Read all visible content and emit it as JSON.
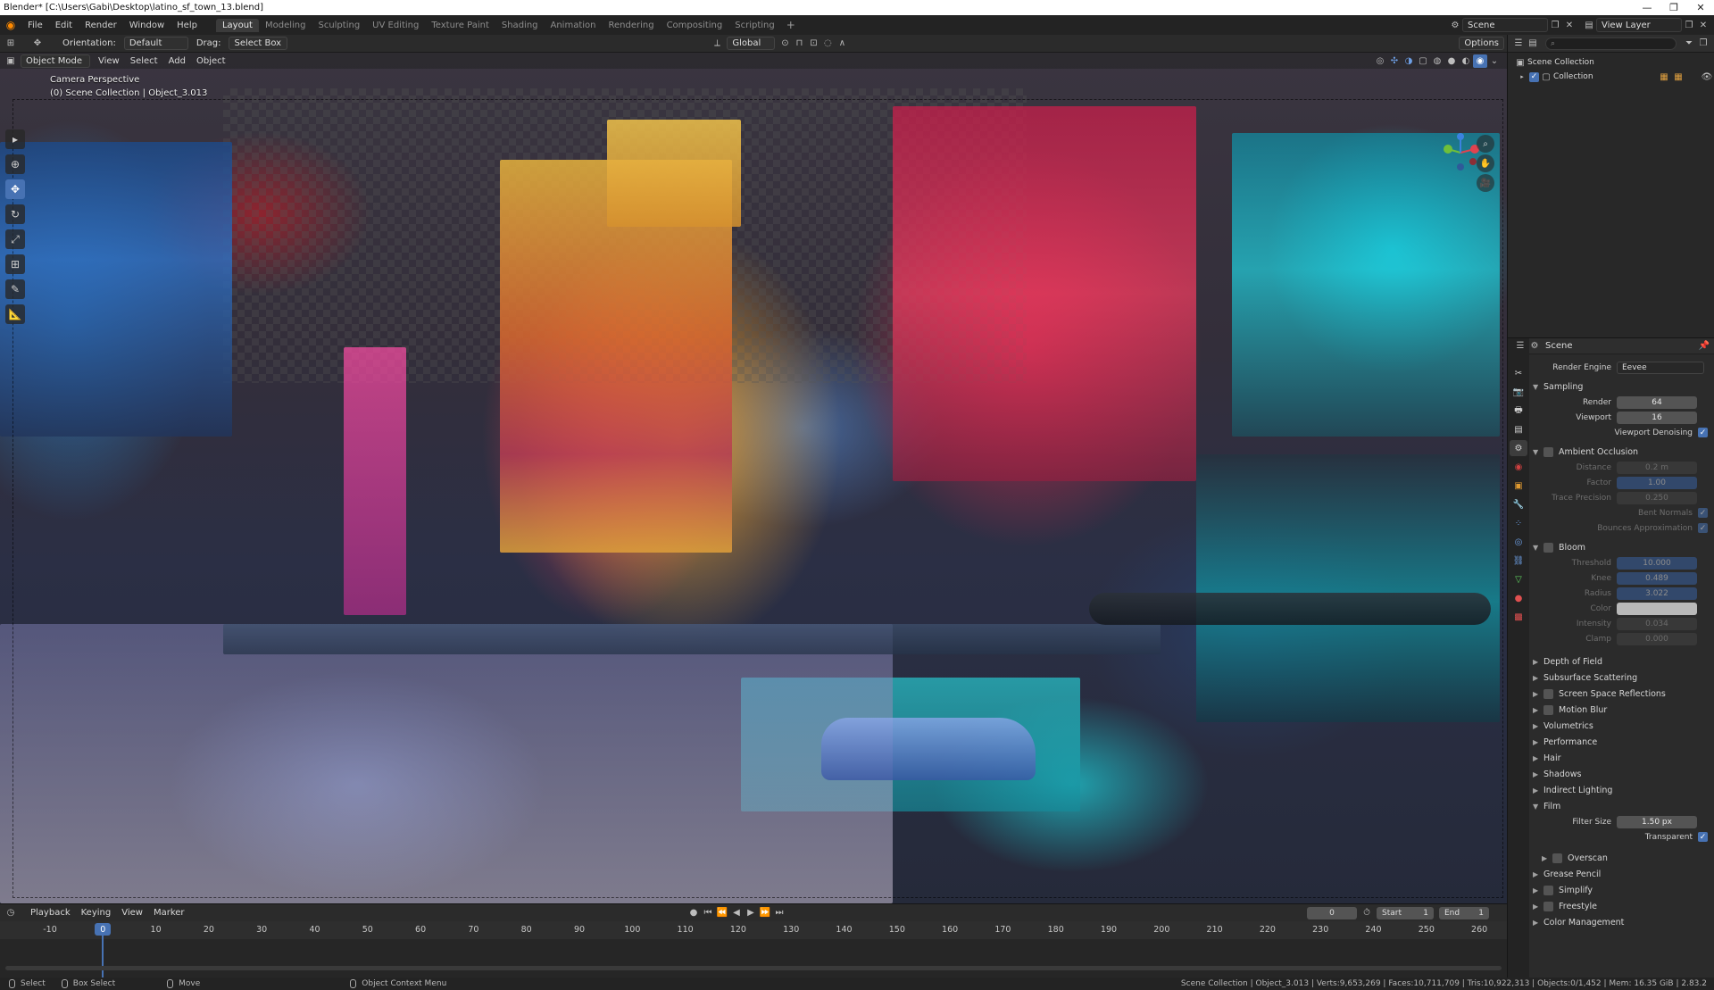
{
  "window": {
    "title": "Blender* [C:\\Users\\Gabi\\Desktop\\latino_sf_town_13.blend]",
    "minimize": "—",
    "maximize": "❐",
    "close": "✕"
  },
  "menu": [
    "File",
    "Edit",
    "Render",
    "Window",
    "Help"
  ],
  "workspaces": [
    "Layout",
    "Modeling",
    "Sculpting",
    "UV Editing",
    "Texture Paint",
    "Shading",
    "Animation",
    "Rendering",
    "Compositing",
    "Scripting"
  ],
  "active_workspace": "Layout",
  "scene_name": "Scene",
  "view_layer": "View Layer",
  "tool_header": {
    "orientation_label": "Orientation:",
    "orientation_value": "Default",
    "drag_label": "Drag:",
    "drag_value": "Select Box",
    "transform_orientation": "Global",
    "options": "Options"
  },
  "viewport_header": {
    "mode": "Object Mode",
    "menus": [
      "View",
      "Select",
      "Add",
      "Object"
    ]
  },
  "viewport": {
    "line1": "Camera Perspective",
    "line2": "(0) Scene Collection | Object_3.013"
  },
  "outliner": {
    "rows": [
      "Scene Collection",
      "Collection"
    ]
  },
  "properties": {
    "context": "Scene",
    "render_engine_label": "Render Engine",
    "render_engine": "Eevee",
    "sampling": {
      "title": "Sampling",
      "render_label": "Render",
      "render": "64",
      "viewport_label": "Viewport",
      "viewport": "16",
      "denoise_label": "Viewport Denoising"
    },
    "ao": {
      "title": "Ambient Occlusion",
      "distance_label": "Distance",
      "distance": "0.2 m",
      "factor_label": "Factor",
      "factor": "1.00",
      "trace_label": "Trace Precision",
      "trace": "0.250",
      "bent_label": "Bent Normals",
      "bounces_label": "Bounces Approximation"
    },
    "bloom": {
      "title": "Bloom",
      "threshold_label": "Threshold",
      "threshold": "10.000",
      "knee_label": "Knee",
      "knee": "0.489",
      "radius_label": "Radius",
      "radius": "3.022",
      "color_label": "Color",
      "intensity_label": "Intensity",
      "intensity": "0.034",
      "clamp_label": "Clamp",
      "clamp": "0.000"
    },
    "panels_a": [
      "Depth of Field",
      "Subsurface Scattering",
      "Screen Space Reflections",
      "Motion Blur",
      "Volumetrics",
      "Performance",
      "Hair",
      "Shadows",
      "Indirect Lighting"
    ],
    "film": {
      "title": "Film",
      "filter_label": "Filter Size",
      "filter": "1.50 px",
      "transparent_label": "Transparent",
      "overscan_label": "Overscan"
    },
    "panels_b": [
      "Grease Pencil",
      "Simplify",
      "Freestyle",
      "Color Management"
    ]
  },
  "timeline": {
    "menus": [
      "Playback",
      "Keying",
      "View",
      "Marker"
    ],
    "current_frame": "0",
    "start_label": "Start",
    "start": "1",
    "end_label": "End",
    "end": "1",
    "ticks": [
      "-10",
      "0",
      "10",
      "20",
      "30",
      "40",
      "50",
      "60",
      "70",
      "80",
      "90",
      "100",
      "110",
      "120",
      "130",
      "140",
      "150",
      "160",
      "170",
      "180",
      "190",
      "200",
      "210",
      "220",
      "230",
      "240",
      "250",
      "260"
    ]
  },
  "statusbar": {
    "select": "Select",
    "box_select": "Box Select",
    "move": "Move",
    "context_menu": "Object Context Menu",
    "stats": "Scene Collection | Object_3.013 | Verts:9,653,269 | Faces:10,711,709 | Tris:10,922,313 | Objects:0/1,452 | Mem: 16.35 GiB | 2.83.2"
  },
  "colors": {
    "accent": "#4772b3",
    "panel": "#2b2b2b",
    "header": "#232323",
    "blender_orange": "#ff8a00"
  }
}
